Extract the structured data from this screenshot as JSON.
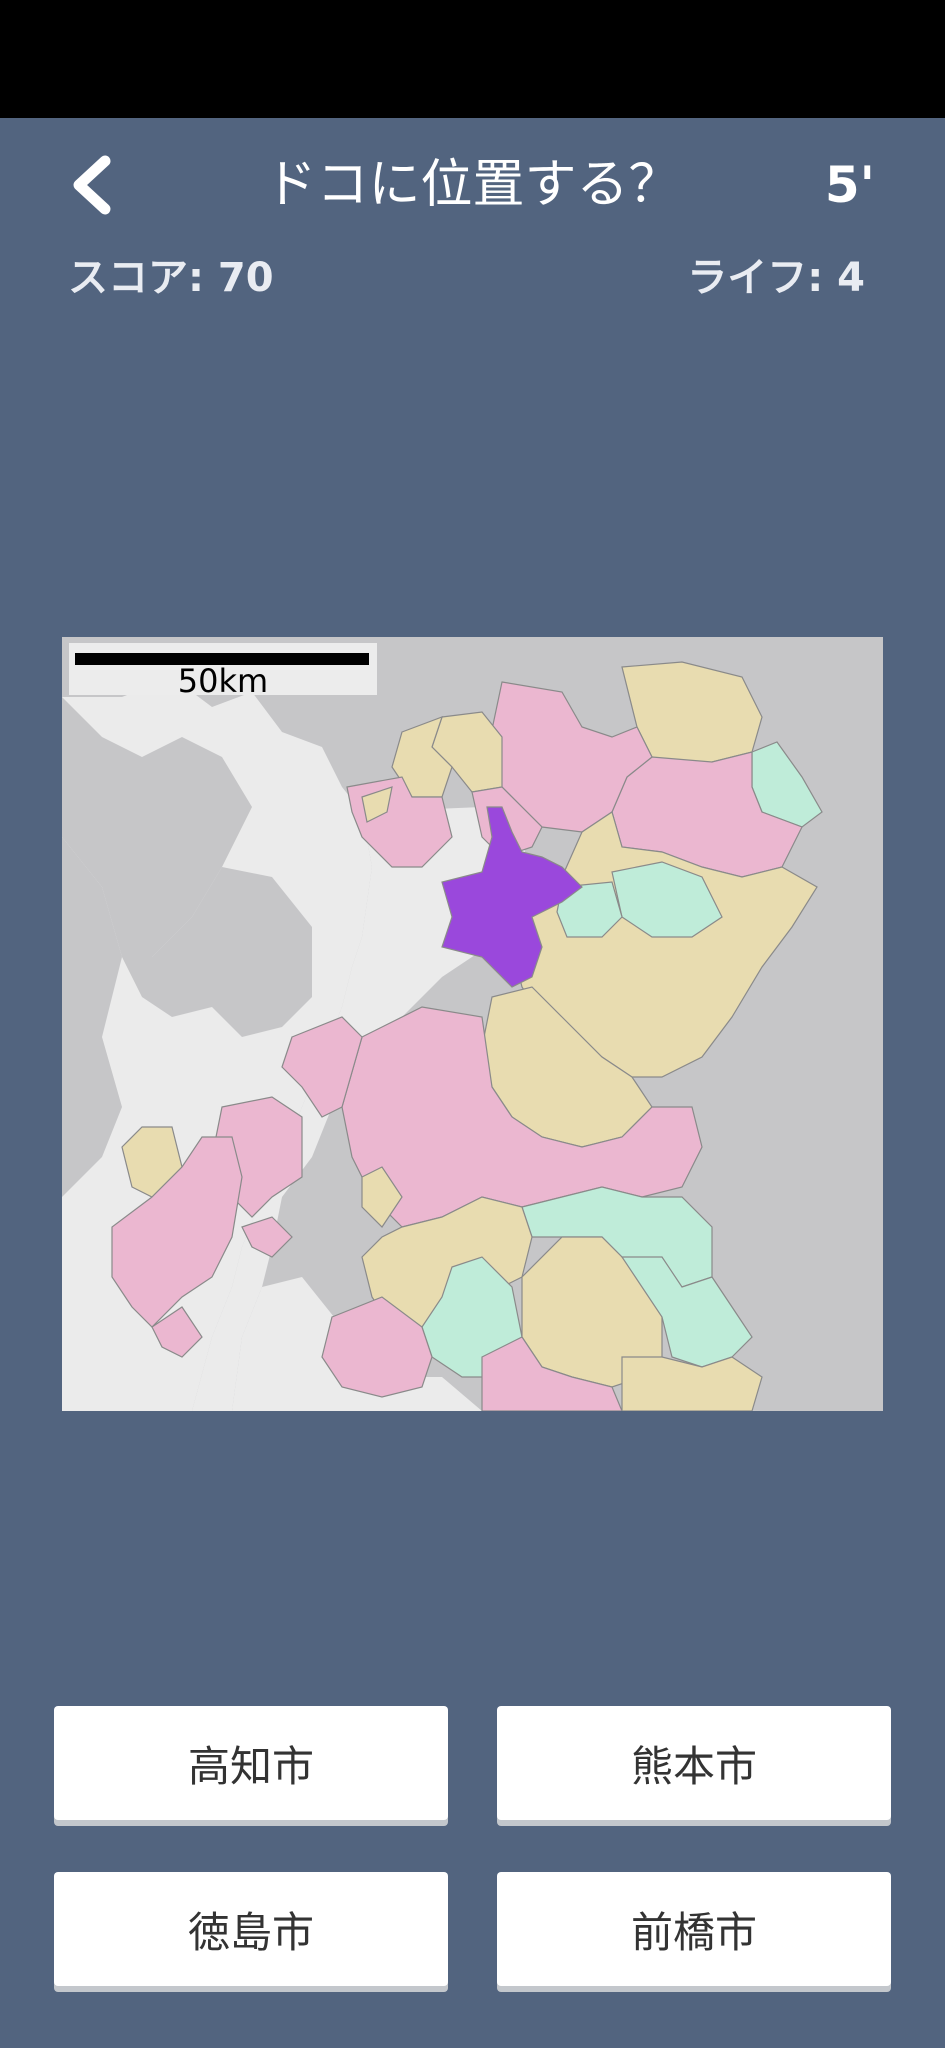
{
  "header": {
    "title": "ドコに位置する？",
    "timer": "5'",
    "back_icon": "chevron-left-icon"
  },
  "stats": {
    "score": "スコア: 70",
    "life": "ライフ: 4"
  },
  "map": {
    "scale_label": "50km",
    "colors": {
      "sea": "#ebebeb",
      "land_outside": "#c6c6c8",
      "pink": "#ebb7d0",
      "tan": "#e8dcb0",
      "mint": "#bfecd9",
      "highlight": "#9a48dc",
      "border": "#8a8a8a"
    }
  },
  "answers": [
    {
      "label": "高知市"
    },
    {
      "label": "熊本市"
    },
    {
      "label": "徳島市"
    },
    {
      "label": "前橋市"
    }
  ]
}
